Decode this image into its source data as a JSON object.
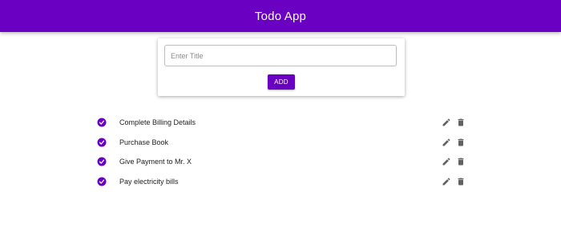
{
  "app": {
    "title": "Todo App"
  },
  "form": {
    "title_placeholder": "Enter Title",
    "title_value": "",
    "add_label": "ADD"
  },
  "todos": [
    {
      "label": "Complete Billing Details",
      "done": true
    },
    {
      "label": "Purchase Book",
      "done": true
    },
    {
      "label": "Give Payment to Mr. X",
      "done": true
    },
    {
      "label": "Pay electricity bills",
      "done": true
    }
  ],
  "icons": {
    "done": "check-circle-icon",
    "edit": "pencil-icon",
    "delete": "trash-icon"
  },
  "colors": {
    "primary": "#6a00c2",
    "icon_gray": "#616161",
    "background": "#ffffff"
  }
}
